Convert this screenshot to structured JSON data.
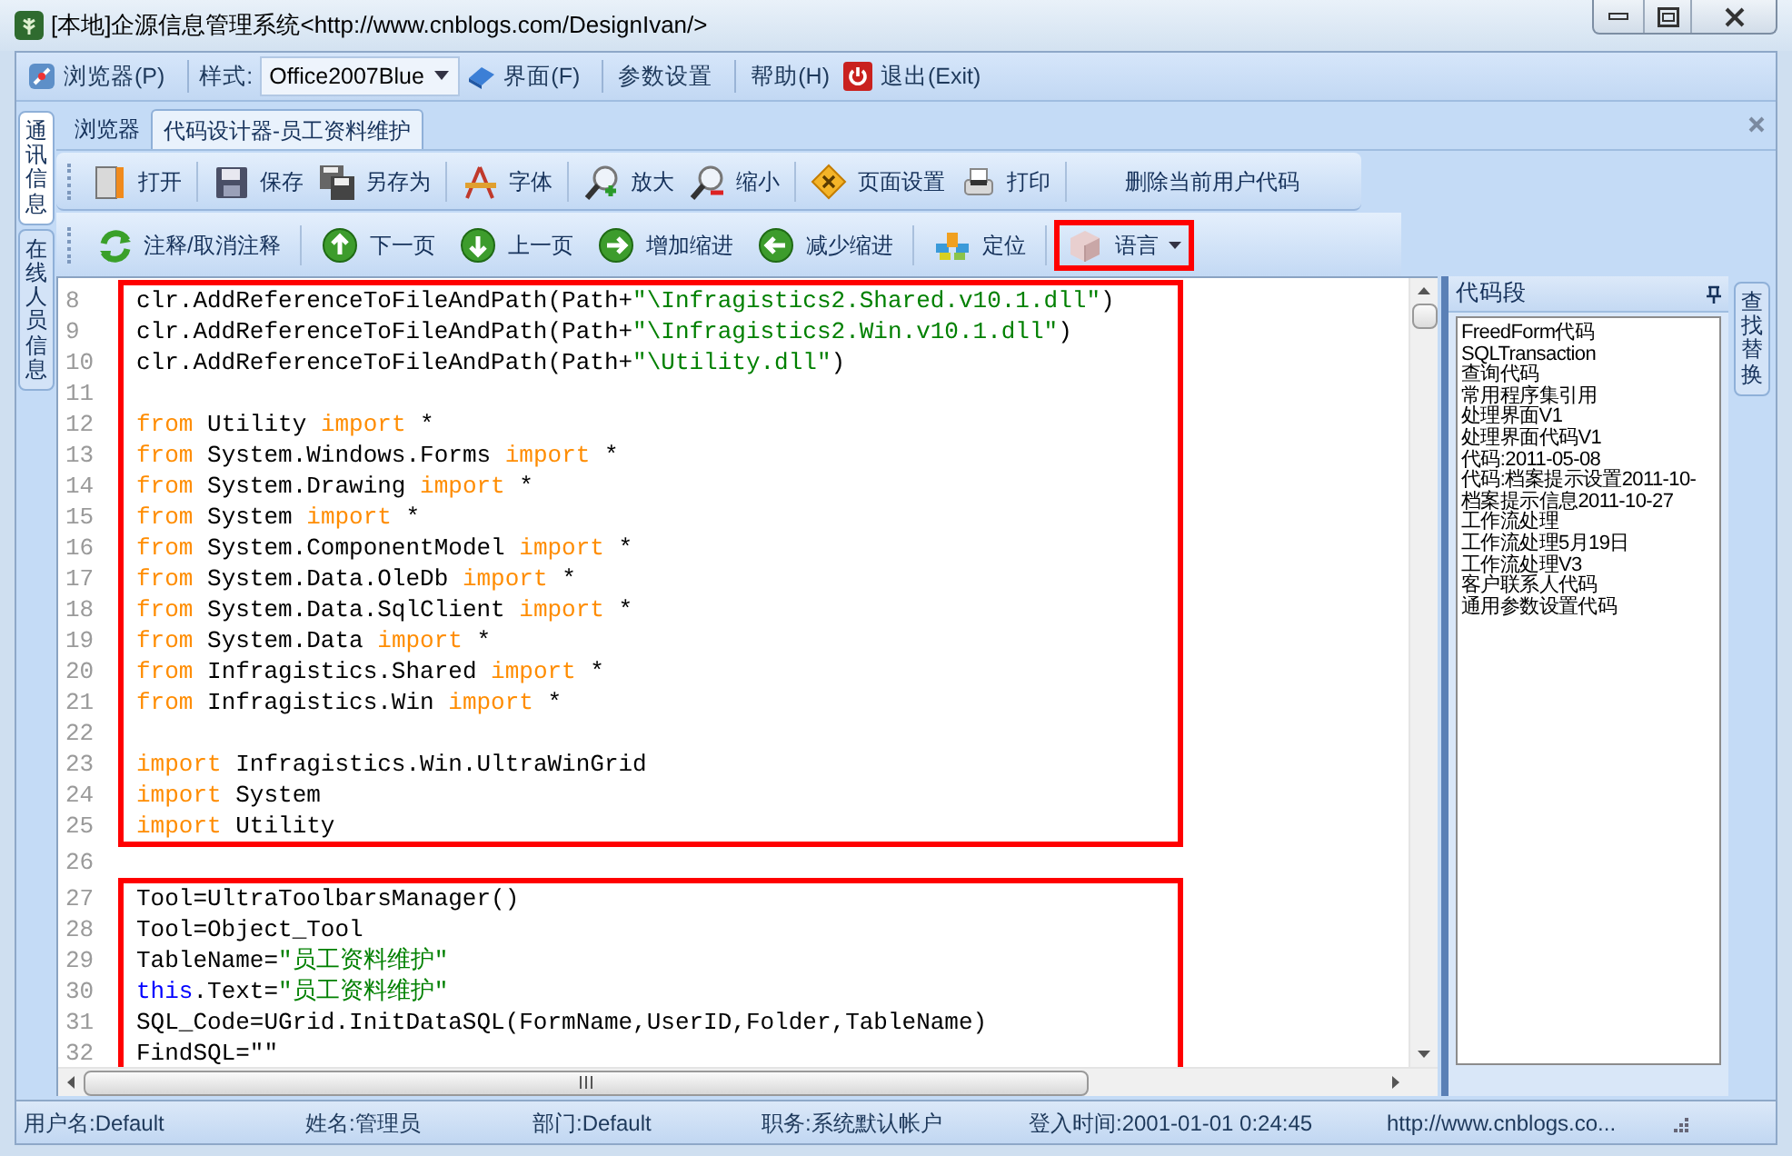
{
  "window": {
    "title": "[本地]企源信息管理系统<http://www.cnblogs.com/DesignIvan/>"
  },
  "menu_bar": {
    "groups": [
      [
        {
          "kind": "item",
          "label": "浏览器(P)"
        }
      ],
      [
        {
          "kind": "label",
          "label": "样式:"
        },
        {
          "kind": "combo",
          "value": "Office2007Blue"
        },
        {
          "kind": "item",
          "label": "界面(F)"
        }
      ],
      [
        {
          "kind": "item",
          "label": "参数设置"
        }
      ],
      [
        {
          "kind": "item",
          "label": "帮助(H)"
        },
        {
          "kind": "item",
          "label": "退出(Exit)"
        }
      ]
    ]
  },
  "left_tabs": [
    {
      "label": "通讯信息",
      "selected": true
    },
    {
      "label": "在线人员信息",
      "selected": false
    }
  ],
  "document_tabs": [
    {
      "label": "浏览器",
      "selected": false
    },
    {
      "label": "代码设计器-员工资料维护",
      "selected": true
    }
  ],
  "toolbar_1": [
    [
      {
        "label": "打开"
      }
    ],
    [
      {
        "label": "保存"
      },
      {
        "label": "另存为"
      }
    ],
    [
      {
        "label": "字体"
      }
    ],
    [
      {
        "label": "放大"
      },
      {
        "label": "缩小"
      }
    ],
    [
      {
        "label": "页面设置"
      },
      {
        "label": "打印"
      }
    ],
    [
      {
        "label": "删除当前用户代码"
      }
    ]
  ],
  "toolbar_2": [
    [
      {
        "label": "注释/取消注释",
        "highlighted": false,
        "dropdown": false
      }
    ],
    [
      {
        "label": "下一页",
        "highlighted": false,
        "dropdown": false
      },
      {
        "label": "上一页",
        "highlighted": false,
        "dropdown": false
      },
      {
        "label": "增加缩进",
        "highlighted": false,
        "dropdown": false
      },
      {
        "label": "减少缩进",
        "highlighted": false,
        "dropdown": false
      }
    ],
    [
      {
        "label": "定位",
        "highlighted": false,
        "dropdown": false
      }
    ],
    [
      {
        "label": "语言",
        "highlighted": true,
        "dropdown": true
      }
    ]
  ],
  "editor": {
    "blocks": [
      {
        "highlighted": true,
        "lines": [
          {
            "number": "8",
            "tokens": [
              {
                "kind": "plain",
                "text": "clr.AddReferenceToFileAndPath(Path+"
              },
              {
                "kind": "string",
                "text": "\"\\Infragistics2.Shared.v10.1.dll\""
              },
              {
                "kind": "plain",
                "text": ")"
              }
            ]
          },
          {
            "number": "9",
            "tokens": [
              {
                "kind": "plain",
                "text": "clr.AddReferenceToFileAndPath(Path+"
              },
              {
                "kind": "string",
                "text": "\"\\Infragistics2.Win.v10.1.dll\""
              },
              {
                "kind": "plain",
                "text": ")"
              }
            ]
          },
          {
            "number": "10",
            "tokens": [
              {
                "kind": "plain",
                "text": "clr.AddReferenceToFileAndPath(Path+"
              },
              {
                "kind": "string",
                "text": "\"\\Utility.dll\""
              },
              {
                "kind": "plain",
                "text": ")"
              }
            ]
          },
          {
            "number": "11"
          },
          {
            "number": "12",
            "tokens": [
              {
                "kind": "keyword",
                "text": "from"
              },
              {
                "kind": "plain",
                "text": " Utility "
              },
              {
                "kind": "keyword",
                "text": "import"
              },
              {
                "kind": "plain",
                "text": " *"
              }
            ]
          },
          {
            "number": "13",
            "tokens": [
              {
                "kind": "keyword",
                "text": "from"
              },
              {
                "kind": "plain",
                "text": " System.Windows.Forms "
              },
              {
                "kind": "keyword",
                "text": "import"
              },
              {
                "kind": "plain",
                "text": " *"
              }
            ]
          },
          {
            "number": "14",
            "tokens": [
              {
                "kind": "keyword",
                "text": "from"
              },
              {
                "kind": "plain",
                "text": " System.Drawing "
              },
              {
                "kind": "keyword",
                "text": "import"
              },
              {
                "kind": "plain",
                "text": " *"
              }
            ]
          },
          {
            "number": "15",
            "tokens": [
              {
                "kind": "keyword",
                "text": "from"
              },
              {
                "kind": "plain",
                "text": " System "
              },
              {
                "kind": "keyword",
                "text": "import"
              },
              {
                "kind": "plain",
                "text": " *"
              }
            ]
          },
          {
            "number": "16",
            "tokens": [
              {
                "kind": "keyword",
                "text": "from"
              },
              {
                "kind": "plain",
                "text": " System.ComponentModel "
              },
              {
                "kind": "keyword",
                "text": "import"
              },
              {
                "kind": "plain",
                "text": " *"
              }
            ]
          },
          {
            "number": "17",
            "tokens": [
              {
                "kind": "keyword",
                "text": "from"
              },
              {
                "kind": "plain",
                "text": " System.Data.OleDb "
              },
              {
                "kind": "keyword",
                "text": "import"
              },
              {
                "kind": "plain",
                "text": " *"
              }
            ]
          },
          {
            "number": "18",
            "tokens": [
              {
                "kind": "keyword",
                "text": "from"
              },
              {
                "kind": "plain",
                "text": " System.Data.SqlClient "
              },
              {
                "kind": "keyword",
                "text": "import"
              },
              {
                "kind": "plain",
                "text": " *"
              }
            ]
          },
          {
            "number": "19",
            "tokens": [
              {
                "kind": "keyword",
                "text": "from"
              },
              {
                "kind": "plain",
                "text": " System.Data "
              },
              {
                "kind": "keyword",
                "text": "import"
              },
              {
                "kind": "plain",
                "text": " *"
              }
            ]
          },
          {
            "number": "20",
            "tokens": [
              {
                "kind": "keyword",
                "text": "from"
              },
              {
                "kind": "plain",
                "text": " Infragistics.Shared "
              },
              {
                "kind": "keyword",
                "text": "import"
              },
              {
                "kind": "plain",
                "text": " *"
              }
            ]
          },
          {
            "number": "21",
            "tokens": [
              {
                "kind": "keyword",
                "text": "from"
              },
              {
                "kind": "plain",
                "text": " Infragistics.Win "
              },
              {
                "kind": "keyword",
                "text": "import"
              },
              {
                "kind": "plain",
                "text": " *"
              }
            ]
          },
          {
            "number": "22"
          },
          {
            "number": "23",
            "tokens": [
              {
                "kind": "keyword",
                "text": "import"
              },
              {
                "kind": "plain",
                "text": " Infragistics.Win.UltraWinGrid"
              }
            ]
          },
          {
            "number": "24",
            "tokens": [
              {
                "kind": "keyword",
                "text": "import"
              },
              {
                "kind": "plain",
                "text": " System"
              }
            ]
          },
          {
            "number": "25",
            "tokens": [
              {
                "kind": "keyword",
                "text": "import"
              },
              {
                "kind": "plain",
                "text": " Utility"
              }
            ]
          }
        ]
      },
      {
        "highlighted": false,
        "lines": [
          {
            "number": "26"
          }
        ]
      },
      {
        "highlighted": true,
        "lines": [
          {
            "number": "27",
            "tokens": [
              {
                "kind": "plain",
                "text": "Tool=UltraToolbarsManager()"
              }
            ]
          },
          {
            "number": "28",
            "tokens": [
              {
                "kind": "plain",
                "text": "Tool=Object_Tool"
              }
            ]
          },
          {
            "number": "29",
            "tokens": [
              {
                "kind": "plain",
                "text": "TableName="
              },
              {
                "kind": "string",
                "text": "\"员工资料维护\""
              }
            ]
          },
          {
            "number": "30",
            "tokens": [
              {
                "kind": "builtin",
                "text": "this"
              },
              {
                "kind": "plain",
                "text": ".Text="
              },
              {
                "kind": "string",
                "text": "\"员工资料维护\""
              }
            ]
          },
          {
            "number": "31",
            "tokens": [
              {
                "kind": "plain",
                "text": "SQL_Code=UGrid.InitDataSQL(FormName,UserID,Folder,TableName)"
              }
            ]
          },
          {
            "number": "32",
            "tokens": [
              {
                "kind": "plain",
                "text": "FindSQL=\"\""
              }
            ]
          }
        ]
      }
    ]
  },
  "snippet_panel": {
    "title": "代码段",
    "items": [
      "FreedForm代码",
      "SQLTransaction",
      "查询代码",
      "常用程序集引用",
      "处理界面V1",
      "处理界面代码V1",
      "代码:2011-05-08",
      "代码:档案提示设置2011-10-",
      "档案提示信息2011-10-27",
      "工作流处理",
      "工作流处理5月19日",
      "工作流处理V3",
      "客户联系人代码",
      "通用参数设置代码"
    ]
  },
  "right_tabs": [
    {
      "label": "查找替换",
      "selected": false
    }
  ],
  "status_bar": [
    "用户名:Default",
    "姓名:管理员",
    "部门:Default",
    "职务:系统默认帐户",
    "登入时间:2001-01-01 0:24:45",
    "http://www.cnblogs.co..."
  ]
}
